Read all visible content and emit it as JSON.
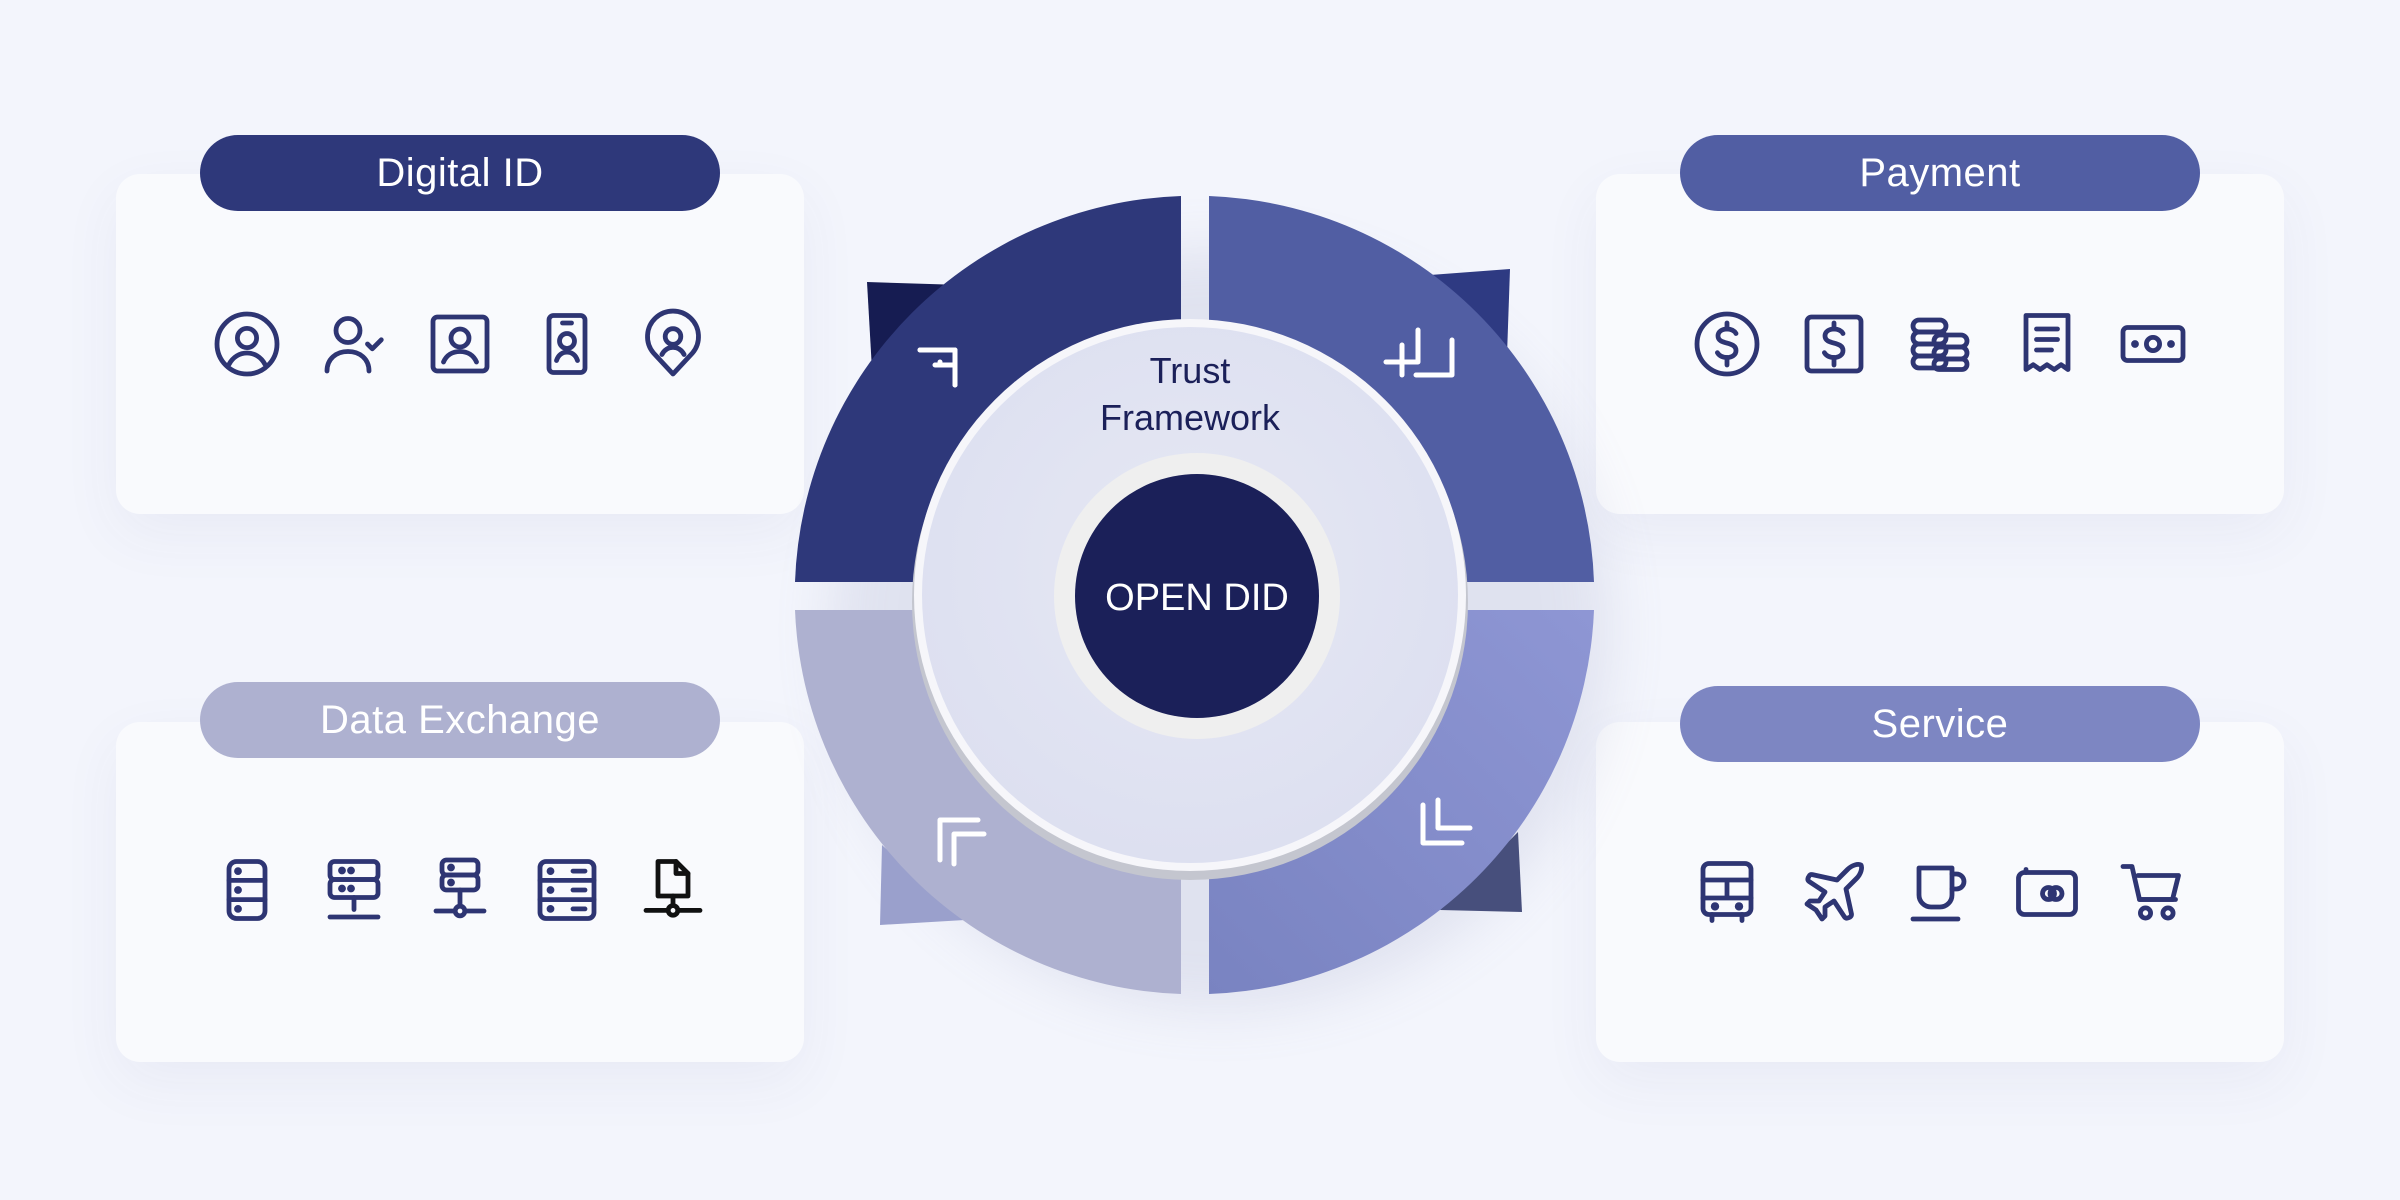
{
  "colors": {
    "background": "#f3f5fc",
    "digital_id": "#2e387a",
    "payment": "#515ea3",
    "data_exchange": "#aeb1d0",
    "service": "#7d86c2",
    "core": "#1b2059",
    "icon": "#2e3573"
  },
  "center": {
    "trust_framework_line1": "Trust",
    "trust_framework_line2": "Framework",
    "core_label": "OPEN DID"
  },
  "cards": {
    "digital_id": {
      "title": "Digital ID",
      "icons": [
        "user-circle-icon",
        "user-check-icon",
        "user-square-icon",
        "id-badge-icon",
        "user-location-icon"
      ]
    },
    "payment": {
      "title": "Payment",
      "icons": [
        "dollar-circle-icon",
        "dollar-square-icon",
        "coin-stack-icon",
        "receipt-icon",
        "banknote-icon"
      ]
    },
    "data_exchange": {
      "title": "Data Exchange",
      "icons": [
        "database-icon",
        "server-icon",
        "server-network-icon",
        "server-rack-icon",
        "file-network-icon"
      ]
    },
    "service": {
      "title": "Service",
      "icons": [
        "bus-icon",
        "airplane-icon",
        "coffee-cup-icon",
        "wallet-card-icon",
        "shopping-cart-icon"
      ]
    }
  }
}
